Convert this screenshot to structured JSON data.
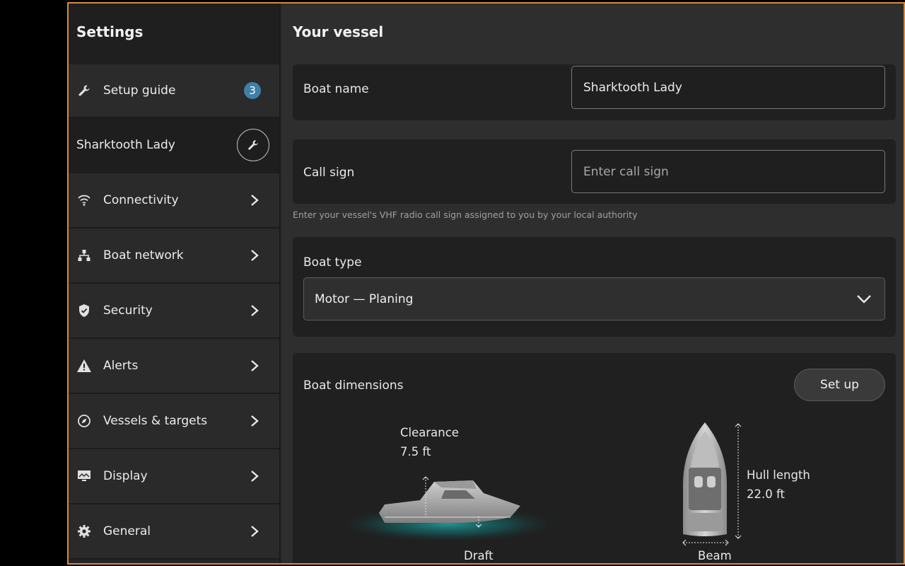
{
  "sidebar": {
    "title": "Settings",
    "setup_guide": {
      "label": "Setup guide",
      "badge": "3"
    },
    "vessel_name": "Sharktooth Lady",
    "items": [
      {
        "label": "Connectivity",
        "icon": "wifi-icon"
      },
      {
        "label": "Boat network",
        "icon": "network-icon"
      },
      {
        "label": "Security",
        "icon": "shield-icon"
      },
      {
        "label": "Alerts",
        "icon": "warning-icon"
      },
      {
        "label": "Vessels & targets",
        "icon": "target-icon"
      },
      {
        "label": "Display",
        "icon": "display-icon"
      },
      {
        "label": "General",
        "icon": "gear-icon"
      }
    ]
  },
  "main": {
    "title": "Your vessel",
    "boat_name": {
      "label": "Boat name",
      "value": "Sharktooth Lady"
    },
    "call_sign": {
      "label": "Call sign",
      "placeholder": "Enter call sign",
      "hint": "Enter your vessel's VHF radio call sign assigned to you by your local authority"
    },
    "boat_type": {
      "label": "Boat type",
      "value": "Motor — Planing"
    },
    "dimensions": {
      "label": "Boat dimensions",
      "setup_button": "Set up",
      "clearance_label": "Clearance",
      "clearance_value": "7.5 ft",
      "hull_length_label": "Hull length",
      "hull_length_value": "22.0 ft",
      "draft_label": "Draft",
      "beam_label": "Beam"
    }
  },
  "colors": {
    "accent_border": "#d98a3a",
    "badge": "#3f7fa8",
    "water_glow": "#1fa6a6"
  }
}
